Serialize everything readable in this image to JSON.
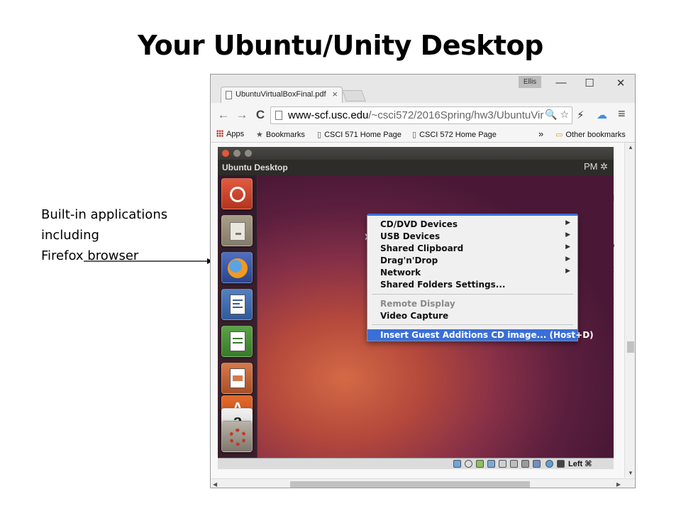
{
  "slide": {
    "title": "Your Ubuntu/Unity Desktop",
    "callout_lines": [
      "Built-in applications",
      "including",
      "Firefox browser"
    ]
  },
  "browser": {
    "tab_title": "UbuntuVirtualBoxFinal.pdf",
    "tab_close": "×",
    "user": "Ellis",
    "window_controls": {
      "minimize": "—",
      "maximize": "☐",
      "close": "✕"
    },
    "nav": {
      "back": "←",
      "forward": "→",
      "reload": "C"
    },
    "url_host": "www-scf.usc.edu",
    "url_path": "/~csci572/2016Spring/hw3/UbuntuVir",
    "omnibox_actions": "🔍 ☆",
    "menu_icon": "≡",
    "bookmarks": {
      "apps": "Apps",
      "bookmarks": "Bookmarks",
      "csci571": "CSCI 571 Home Page",
      "csci572": "CSCI 572 Home Page",
      "overflow": "»",
      "other": "Other bookmarks"
    }
  },
  "ubuntu": {
    "panel_title": "Ubuntu Desktop",
    "panel_right": "PM ✲",
    "launcher_software_letter": "A",
    "launcher_amazon_letter": "a",
    "statusbar_host_key": "Left ⌘"
  },
  "vbox_menu": {
    "items": [
      {
        "label": "CD/DVD Devices",
        "submenu": "▶"
      },
      {
        "label": "USB Devices",
        "submenu": "▶"
      },
      {
        "label": "Shared Clipboard",
        "submenu": "▶"
      },
      {
        "label": "Drag'n'Drop",
        "submenu": "▶"
      },
      {
        "label": "Network",
        "submenu": "▶"
      },
      {
        "label": "Shared Folders Settings..."
      }
    ],
    "remote_display": "Remote Display",
    "video_capture": "Video Capture",
    "insert_guest_additions": "Insert Guest Additions CD image... (Host+D)"
  },
  "colors": {
    "menu_highlight": "#3a6fd8",
    "ubuntu_orange": "#dd4814",
    "ubuntu_aubergine": "#5c1f3e"
  }
}
